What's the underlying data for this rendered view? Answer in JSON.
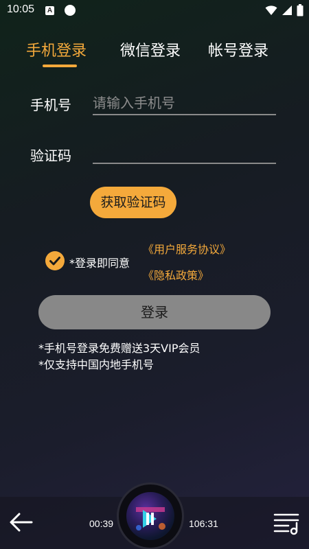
{
  "status_bar": {
    "time": "10:05",
    "notification_icon": "a-icon",
    "dot_icon": "circle-icon",
    "wifi_icon": "wifi-icon",
    "signal_icon": "signal-icon",
    "battery_icon": "battery-icon"
  },
  "tabs": [
    {
      "label": "手机登录",
      "active": true
    },
    {
      "label": "微信登录",
      "active": false
    },
    {
      "label": "帐号登录",
      "active": false
    }
  ],
  "form": {
    "phone_label": "手机号",
    "phone_placeholder": "请输入手机号",
    "phone_value": "",
    "code_label": "验证码",
    "code_placeholder": "",
    "code_value": "",
    "get_code_label": "获取验证码"
  },
  "agreement": {
    "checked": true,
    "text": "*登录即同意",
    "terms_link": "《用户服务协议》",
    "privacy_link": "《隐私政策》"
  },
  "login_label": "登录",
  "notes": [
    "*手机号登录免费赠送3天VIP会员",
    "*仅支持中国内地手机号"
  ],
  "player": {
    "elapsed": "00:39",
    "total": "106:31",
    "back_icon": "arrow-left-icon",
    "playlist_icon": "playlist-icon"
  },
  "colors": {
    "accent": "#f4a93b",
    "button_disabled": "#888888",
    "text": "#ffffff",
    "placeholder": "#8c8c8c"
  }
}
